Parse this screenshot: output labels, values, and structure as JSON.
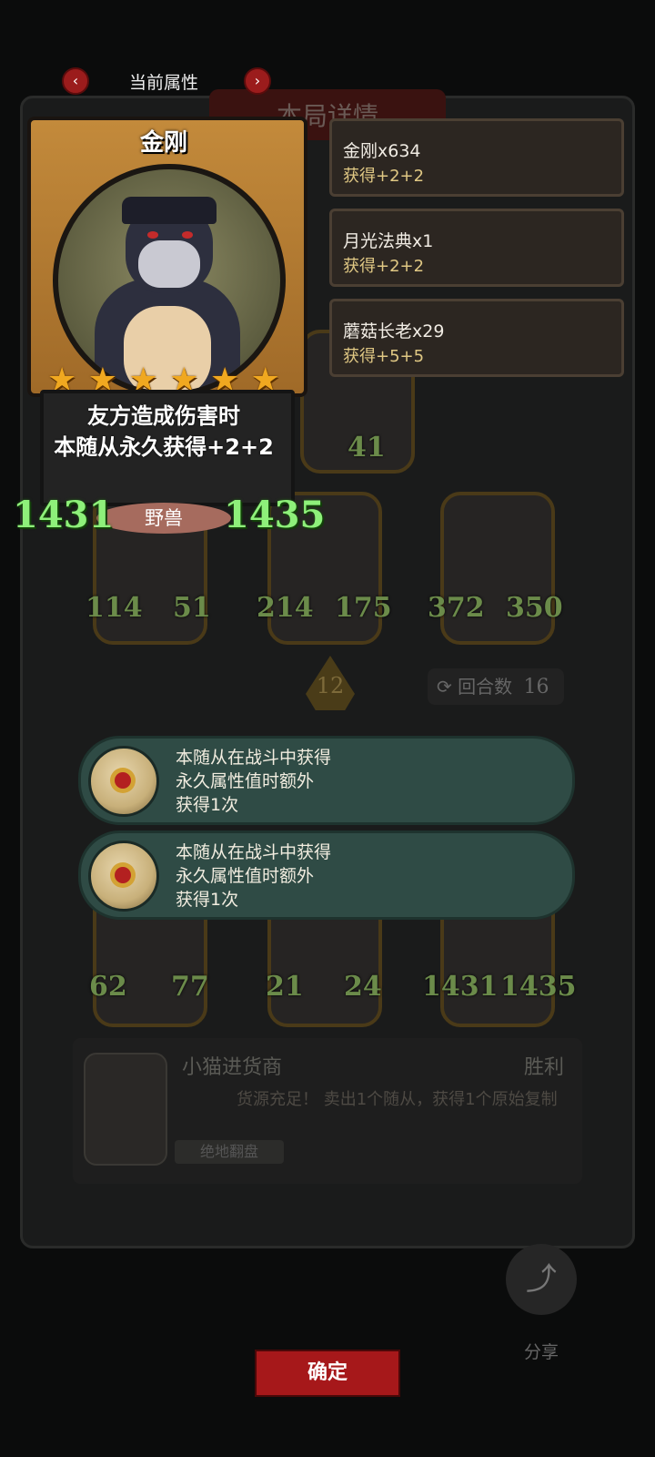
{
  "top": {
    "title": "当前属性"
  },
  "board": {
    "header": "本局详情",
    "level": "12",
    "round_label": "回合数",
    "round_value": "16",
    "cards": [
      {
        "atk": "41",
        "hp": ""
      },
      {
        "atk": "114",
        "hp": "51"
      },
      {
        "atk": "214",
        "hp": "175"
      },
      {
        "atk": "372",
        "hp": "350"
      },
      {
        "atk": "62",
        "hp": "77"
      },
      {
        "atk": "21",
        "hp": "24"
      },
      {
        "atk": "1431",
        "hp": "1435"
      }
    ],
    "merchant": {
      "name": "小猫进货商",
      "result": "胜利",
      "desc": "货源充足！ 卖出1个随从，获得1个原始复制",
      "tag": "绝地翻盘"
    }
  },
  "hero": {
    "name": "金刚",
    "stars": 6,
    "desc_line1": "友方造成伤害时",
    "desc_line2": "本随从永久获得+2+2",
    "type": "野兽",
    "atk": "1431",
    "hp": "1435"
  },
  "sources": [
    {
      "name": "金刚x634",
      "gain": "获得+2+2"
    },
    {
      "name": "月光法典x1",
      "gain": "获得+2+2"
    },
    {
      "name": "蘑菇长老x29",
      "gain": "获得+5+5"
    }
  ],
  "relics": [
    {
      "line1": "本随从在战斗中获得",
      "line2": "永久属性值时额外",
      "line3": "获得1次"
    },
    {
      "line1": "本随从在战斗中获得",
      "line2": "永久属性值时额外",
      "line3": "获得1次"
    }
  ],
  "bottom": {
    "share": "分享",
    "confirm": "确定"
  },
  "colors": {
    "stat_green": "#8ef07a",
    "confirm_red": "#a6181a",
    "relic_teal": "#2f4b45"
  }
}
